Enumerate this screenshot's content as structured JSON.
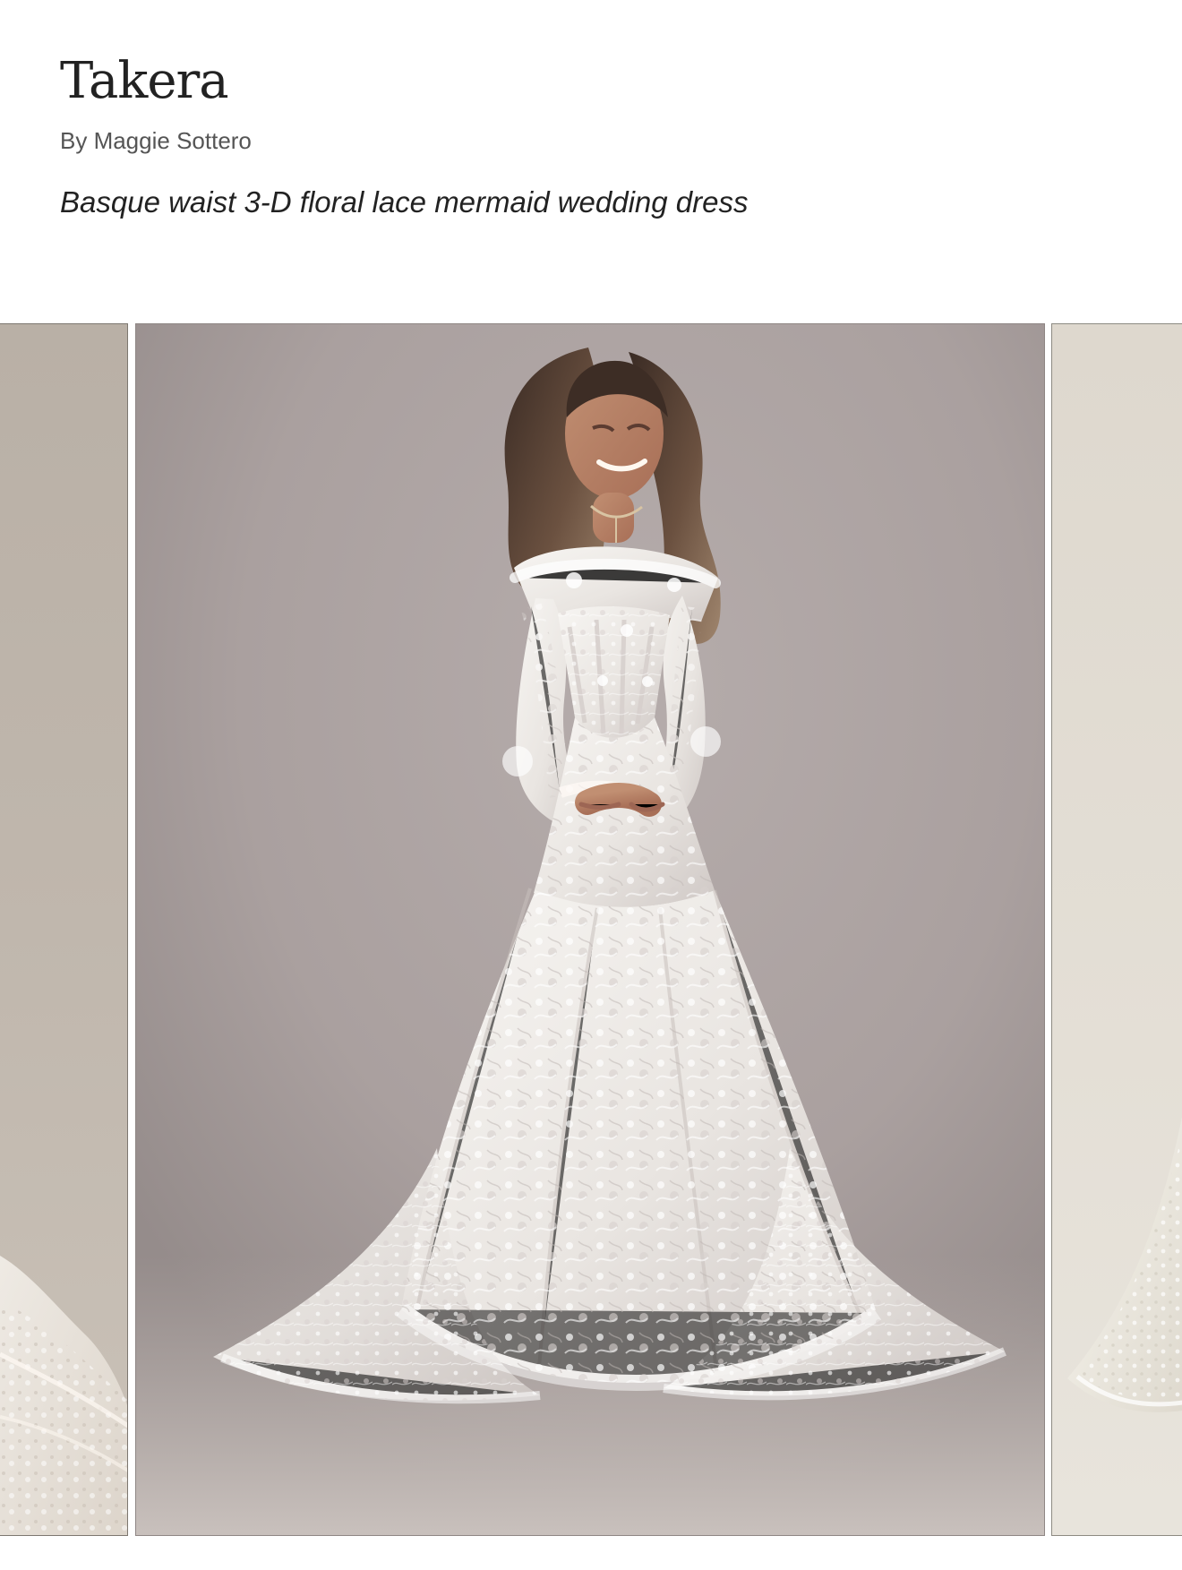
{
  "product": {
    "title": "Takera",
    "brand_line": "By Maggie Sottero",
    "description": "Basque waist 3-D floral lace mermaid wedding dress"
  },
  "carousel": {
    "current_image_alt": "Takera wedding dress",
    "previous_image_alt": "Previous wedding dress image",
    "next_image_alt": "Next wedding dress image"
  },
  "icons": {
    "favorite": "heart-icon"
  },
  "colors": {
    "text": "#222222",
    "secondary_text": "#555555",
    "photo_background": "#aaa0a0",
    "lace": "#eeeae6"
  }
}
